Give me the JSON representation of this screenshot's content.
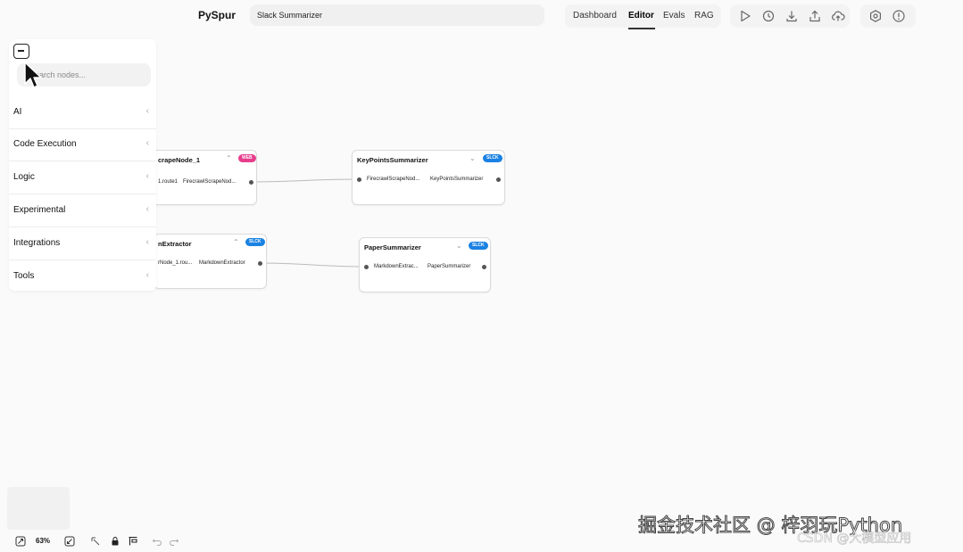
{
  "header": {
    "brand": "PySpur",
    "workflow_name": "Slack Summarizer",
    "nav": [
      "Dashboard",
      "Editor",
      "Evals",
      "RAG"
    ],
    "active_nav": "Editor",
    "toolbar_icons": [
      "play-icon",
      "history-icon",
      "download-icon",
      "upload-icon",
      "cloud-deploy-icon"
    ],
    "toolbar_icons_right": [
      "settings-icon",
      "help-icon"
    ]
  },
  "sidebar": {
    "search_placeholder": "Search nodes...",
    "categories": [
      {
        "label": "AI"
      },
      {
        "label": "Code Execution"
      },
      {
        "label": "Logic"
      },
      {
        "label": "Experimental"
      },
      {
        "label": "Integrations"
      },
      {
        "label": "Tools"
      }
    ]
  },
  "nodes": [
    {
      "title": "crapeNode_1",
      "badge": "WEB",
      "badge_color": "#e63e8c",
      "input": "1.route1",
      "output": "FirecrawlScrapeNod..."
    },
    {
      "title": "KeyPointsSummarizer",
      "badge": "SLCK",
      "badge_color": "#1a82e2",
      "input": "FirecrawlScrapeNod...",
      "output": "KeyPointsSummarizer"
    },
    {
      "title": "nExtractor",
      "badge": "SLCK",
      "badge_color": "#1a82e2",
      "input": "rNode_1.rou...",
      "output": "MarkdownExtractor"
    },
    {
      "title": "PaperSummarizer",
      "badge": "SLCK",
      "badge_color": "#1a82e2",
      "input": "MarkdownExtrac...",
      "output": "PaperSummarizer"
    }
  ],
  "bottom": {
    "zoom": "63%"
  },
  "watermark": {
    "line1": "掘金技术社区 @ 梓羽玩Python",
    "line2": "CSDN @大模型应用"
  }
}
